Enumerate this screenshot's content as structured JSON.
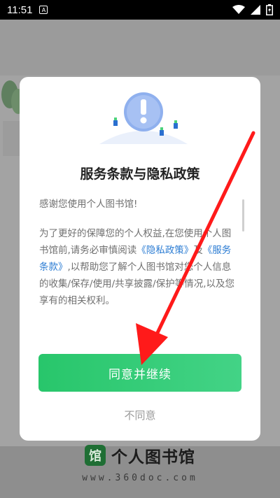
{
  "status_bar": {
    "time": "11:51",
    "badge": "A"
  },
  "dialog": {
    "title": "服务条款与隐私政策",
    "greeting": "感谢您使用个人图书馆!",
    "para_1": "为了更好的保障您的个人权益,在您使用个人图书馆前,请务必审慎阅读",
    "privacy_link": "《隐私政策》",
    "conj": "及",
    "terms_link": "《服务条款》",
    "para_2": ",以帮助您了解个人图书馆对您个人信息的收集/保存/使用/共享披露/保护等情况,以及您享有的相关权利。",
    "agree_label": "同意并继续",
    "disagree_label": "不同意"
  },
  "background": {
    "brand_logo_char": "馆",
    "brand_name": "个人图书馆",
    "brand_url": "www.360doc.com"
  },
  "colors": {
    "accent": "#2fca73",
    "link": "#2b7cd3",
    "arrow": "#ff1a1a"
  },
  "icons": [
    "wifi-icon",
    "signal-icon",
    "battery-icon",
    "warning-icon",
    "arrow-annotation"
  ]
}
